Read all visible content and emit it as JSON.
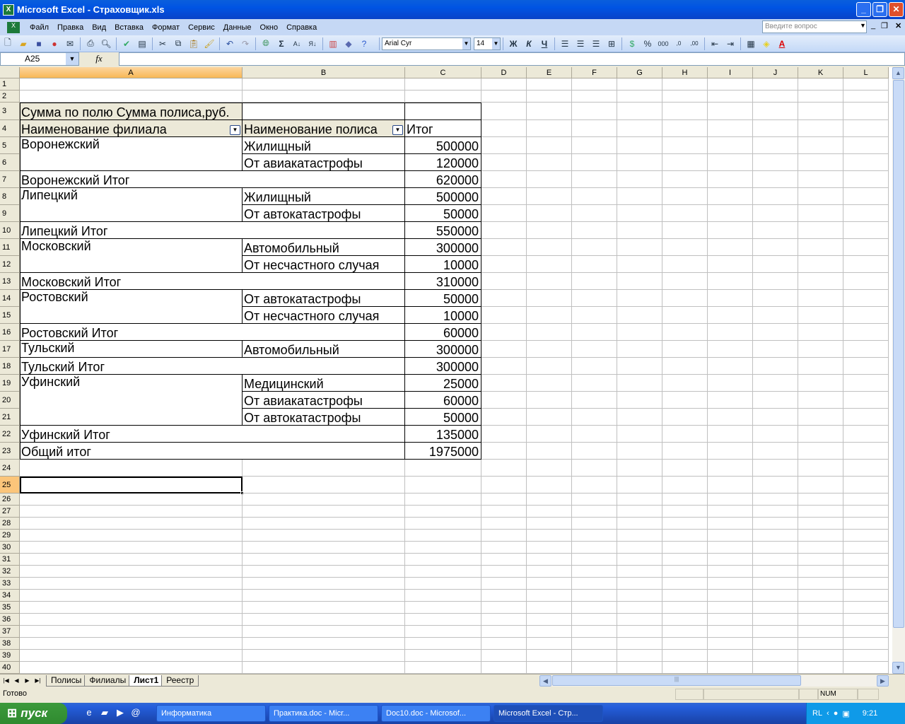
{
  "window": {
    "title": "Microsoft Excel - Страховщик.xls",
    "app_icon": "excel-icon"
  },
  "menu": [
    "Файл",
    "Правка",
    "Вид",
    "Вставка",
    "Формат",
    "Сервис",
    "Данные",
    "Окно",
    "Справка"
  ],
  "help_placeholder": "Введите вопрос",
  "toolbar": {
    "font": "Arial Cyr",
    "size": "14",
    "bold": "Ж",
    "italic": "К",
    "underline": "Ч",
    "percent": "%",
    "thousands": "000"
  },
  "formula_bar": {
    "name_box": "A25",
    "fx": "fx",
    "value": ""
  },
  "sheet": {
    "columns": [
      "A",
      "B",
      "C",
      "D",
      "E",
      "F",
      "G",
      "H",
      "I",
      "J",
      "K",
      "L"
    ],
    "row_count": 40,
    "active_cell": "A25",
    "pivot": {
      "title": "Сумма по полю Сумма полиса,руб.",
      "header_branch": "Наименование филиала",
      "header_policy": "Наименование полиса",
      "header_total": "Итог",
      "groups": [
        {
          "branch": "Воронежский",
          "items": [
            {
              "name": "Жилищный",
              "value": "500000"
            },
            {
              "name": "От авиакатастрофы",
              "value": "120000"
            }
          ],
          "total_label": "Воронежский Итог",
          "total": "620000"
        },
        {
          "branch": "Липецкий",
          "items": [
            {
              "name": "Жилищный",
              "value": "500000"
            },
            {
              "name": "От автокатастрофы",
              "value": "50000"
            }
          ],
          "total_label": "Липецкий  Итог",
          "total": "550000"
        },
        {
          "branch": "Московский",
          "items": [
            {
              "name": "Автомобильный",
              "value": "300000"
            },
            {
              "name": "От несчастного случая",
              "value": "10000"
            }
          ],
          "total_label": "Московский Итог",
          "total": "310000"
        },
        {
          "branch": "Ростовский",
          "items": [
            {
              "name": "От автокатастрофы",
              "value": "50000"
            },
            {
              "name": "От несчастного случая",
              "value": "10000"
            }
          ],
          "total_label": "Ростовский Итог",
          "total": "60000"
        },
        {
          "branch": "Тульский",
          "items": [
            {
              "name": "Автомобильный",
              "value": "300000"
            }
          ],
          "total_label": "Тульский Итог",
          "total": "300000"
        },
        {
          "branch": "Уфинский",
          "items": [
            {
              "name": "Медицинский",
              "value": "25000"
            },
            {
              "name": "От авиакатастрофы",
              "value": "60000"
            },
            {
              "name": "От автокатастрофы",
              "value": "50000"
            }
          ],
          "total_label": "Уфинский Итог",
          "total": "135000"
        }
      ],
      "grand_total_label": "Общий итог",
      "grand_total": "1975000"
    }
  },
  "sheet_tabs": [
    {
      "label": "Полисы",
      "active": false
    },
    {
      "label": "Филиалы",
      "active": false
    },
    {
      "label": "Лист1",
      "active": true
    },
    {
      "label": "Реестр",
      "active": false
    }
  ],
  "status": {
    "text": "Готово",
    "num": "NUM"
  },
  "taskbar": {
    "start": "пуск",
    "tasks": [
      {
        "label": "Информатика",
        "active": false
      },
      {
        "label": "Практика.doc - Micr...",
        "active": false
      },
      {
        "label": "Doc10.doc - Microsof...",
        "active": false
      },
      {
        "label": "Microsoft Excel - Стр...",
        "active": true
      }
    ],
    "lang": "RL",
    "clock": "9:21"
  }
}
